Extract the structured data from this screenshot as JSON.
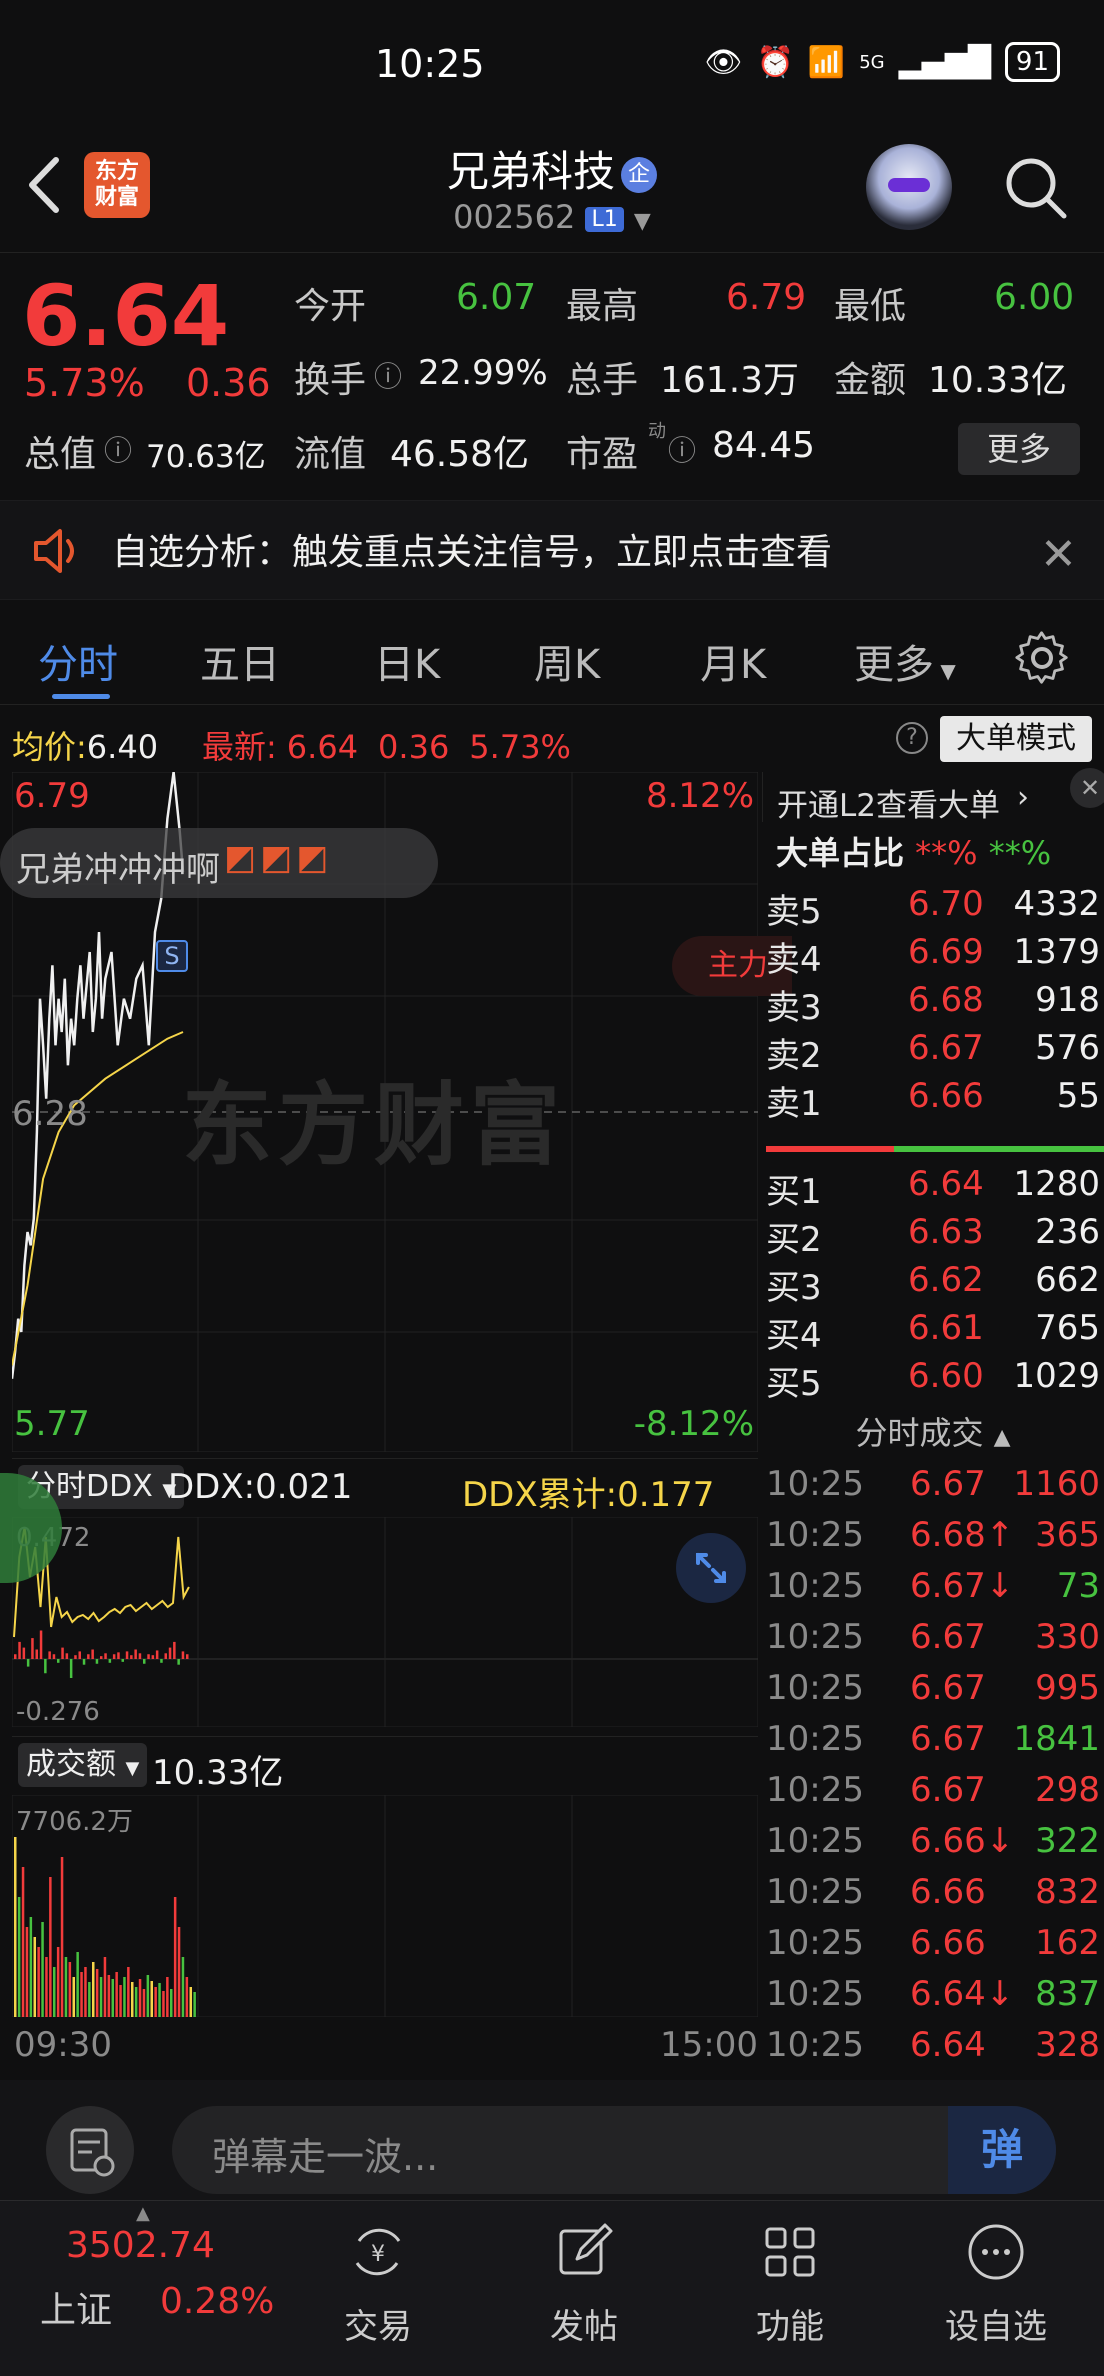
{
  "status": {
    "time": "10:25",
    "battery": "91",
    "network": "5G"
  },
  "header": {
    "back_icon": "chevron-left-icon",
    "app_logo": "东方\n财富",
    "stock_name": "兄弟科技",
    "ent_badge": "企",
    "stock_code": "002562",
    "level_badge": "L1"
  },
  "quote": {
    "price": "6.64",
    "pct": "5.73%",
    "chg": "0.36",
    "open_label": "今开",
    "open": "6.07",
    "high_label": "最高",
    "high": "6.79",
    "low_label": "最低",
    "low": "6.00",
    "turnover_label": "换手",
    "turnover": "22.99%",
    "volume_label": "总手",
    "volume": "161.3万",
    "amount_label": "金额",
    "amount": "10.33亿",
    "mktcap_label": "总值",
    "mktcap": "70.63亿",
    "float_label": "流值",
    "float_cap": "46.58亿",
    "pe_label": "市盈",
    "pe_sup": "动",
    "pe": "84.45",
    "more": "更多"
  },
  "banner": {
    "text": "自选分析：触发重点关注信号，立即点击查看"
  },
  "tabs": [
    "分时",
    "五日",
    "日K",
    "周K",
    "月K",
    "更多"
  ],
  "infoline": {
    "avg_label": "均价:",
    "avg": "6.40",
    "latest_label": "最新:",
    "latest": "6.64",
    "chg": "0.36",
    "pct": "5.73%",
    "big_order_mode": "大单模式"
  },
  "chart": {
    "top_price": "6.79",
    "top_pct": "8.12%",
    "mid_price": "6.28",
    "bottom_price": "5.77",
    "bottom_pct": "-8.12%",
    "watermark": "东方财富",
    "bullet": "兄弟冲冲冲啊",
    "s_marker": "S",
    "side_tag": "主力",
    "start_time": "09:30",
    "end_time": "15:00"
  },
  "chart_data": {
    "type": "line",
    "series": [
      {
        "x": [
          "09:30",
          "09:31",
          "09:32",
          "09:33",
          "09:34",
          "09:35",
          "09:36",
          "09:37",
          "09:38",
          "09:39",
          "09:40",
          "09:41",
          "09:42",
          "09:43",
          "09:44",
          "09:45",
          "09:46",
          "09:47",
          "09:48",
          "09:49",
          "09:50",
          "09:51",
          "09:52",
          "09:53",
          "09:54",
          "09:55",
          "09:56",
          "09:57",
          "09:58",
          "09:59",
          "10:00",
          "10:02",
          "10:04",
          "10:06",
          "10:08",
          "10:10",
          "10:12",
          "10:14",
          "10:16",
          "10:18",
          "10:20",
          "10:22",
          "10:24",
          "10:25"
        ],
        "values": [
          5.88,
          5.92,
          5.97,
          5.95,
          6.05,
          6.1,
          6.08,
          6.12,
          6.25,
          6.45,
          6.38,
          6.3,
          6.42,
          6.5,
          6.38,
          6.45,
          6.4,
          6.48,
          6.35,
          6.42,
          6.38,
          6.45,
          6.5,
          6.42,
          6.47,
          6.52,
          6.4,
          6.45,
          6.55,
          6.42,
          6.48,
          6.52,
          6.38,
          6.45,
          6.42,
          6.48,
          6.5,
          6.38,
          6.55,
          6.6,
          6.72,
          6.79,
          6.7,
          6.64
        ]
      },
      {
        "x": [
          "09:30",
          "09:35",
          "09:40",
          "09:45",
          "09:50",
          "10:00",
          "10:10",
          "10:20",
          "10:25"
        ],
        "values": [
          5.9,
          6.02,
          6.18,
          6.25,
          6.29,
          6.33,
          6.36,
          6.39,
          6.4
        ]
      }
    ],
    "ylim": [
      5.77,
      6.79
    ]
  },
  "book": {
    "l2_prompt": "开通L2查看大单",
    "ratio_label": "大单占比",
    "ratio_red": "**%",
    "ratio_green": "**%",
    "asks": [
      {
        "label": "卖5",
        "price": "6.70",
        "vol": "4332"
      },
      {
        "label": "卖4",
        "price": "6.69",
        "vol": "1379"
      },
      {
        "label": "卖3",
        "price": "6.68",
        "vol": "918"
      },
      {
        "label": "卖2",
        "price": "6.67",
        "vol": "576"
      },
      {
        "label": "卖1",
        "price": "6.66",
        "vol": "55"
      }
    ],
    "bids": [
      {
        "label": "买1",
        "price": "6.64",
        "vol": "1280"
      },
      {
        "label": "买2",
        "price": "6.63",
        "vol": "236"
      },
      {
        "label": "买3",
        "price": "6.62",
        "vol": "662"
      },
      {
        "label": "买4",
        "price": "6.61",
        "vol": "765"
      },
      {
        "label": "买5",
        "price": "6.60",
        "vol": "1029"
      }
    ],
    "trades_title": "分时成交",
    "trades": [
      {
        "t": "10:25",
        "p": "6.67",
        "v": "1160",
        "vc": "red"
      },
      {
        "t": "10:25",
        "p": "6.68↑",
        "v": "365",
        "vc": "red"
      },
      {
        "t": "10:25",
        "p": "6.67↓",
        "v": "73",
        "vc": "green"
      },
      {
        "t": "10:25",
        "p": "6.67",
        "v": "330",
        "vc": "red"
      },
      {
        "t": "10:25",
        "p": "6.67",
        "v": "995",
        "vc": "red"
      },
      {
        "t": "10:25",
        "p": "6.67",
        "v": "1841",
        "vc": "green"
      },
      {
        "t": "10:25",
        "p": "6.67",
        "v": "298",
        "vc": "red"
      },
      {
        "t": "10:25",
        "p": "6.66↓",
        "v": "322",
        "vc": "green"
      },
      {
        "t": "10:25",
        "p": "6.66",
        "v": "832",
        "vc": "red"
      },
      {
        "t": "10:25",
        "p": "6.66",
        "v": "162",
        "vc": "red"
      },
      {
        "t": "10:25",
        "p": "6.64↓",
        "v": "837",
        "vc": "green"
      },
      {
        "t": "10:25",
        "p": "6.64",
        "v": "328",
        "vc": "red"
      }
    ]
  },
  "ddx": {
    "selector": "分时DDX",
    "ddx_label": "DDX:0.021",
    "cum_label": "DDX累计:0.177",
    "top": "0.472",
    "bottom": "-0.276"
  },
  "vol": {
    "selector": "成交额",
    "amount": "10.33亿",
    "top": "7706.2万"
  },
  "input": {
    "placeholder": "弹幕走一波...",
    "dan": "弹"
  },
  "nav": {
    "index_value": "3502.74",
    "index_name": "上证",
    "index_pct": "0.28%",
    "items": [
      {
        "label": "交易"
      },
      {
        "label": "发帖"
      },
      {
        "label": "功能"
      },
      {
        "label": "设自选"
      }
    ]
  }
}
